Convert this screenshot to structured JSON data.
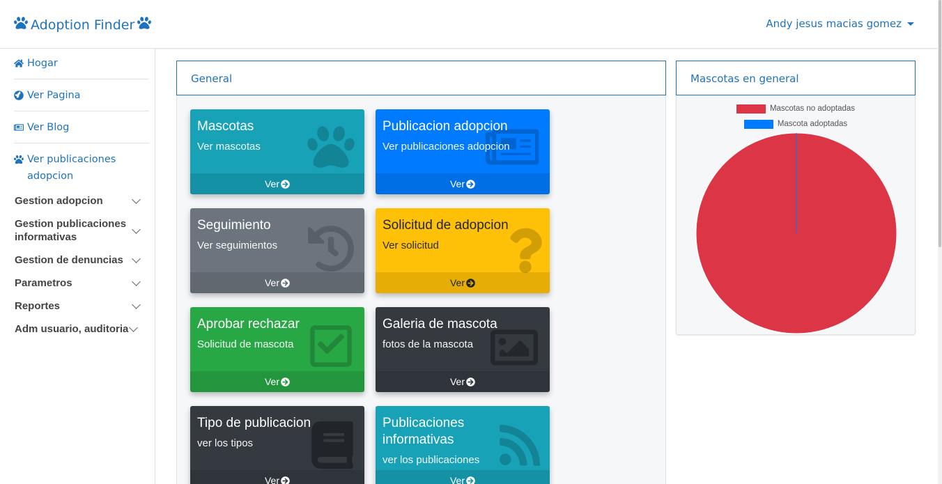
{
  "app": {
    "brand": "Adoption Finder",
    "user_name": "Andy jesus macias gomez"
  },
  "sidebar": {
    "links": [
      {
        "label": "Hogar",
        "icon": "home-icon"
      },
      {
        "label": "Ver Pagina",
        "icon": "globe-icon"
      },
      {
        "label": "Ver Blog",
        "icon": "newspaper-icon"
      },
      {
        "label": "Ver publicaciones adopcion",
        "icon": "paw-icon"
      }
    ],
    "groups": [
      {
        "label": "Gestion adopcion"
      },
      {
        "label": "Gestion publicaciones informativas"
      },
      {
        "label": "Gestion de denuncias"
      },
      {
        "label": "Parametros"
      },
      {
        "label": "Reportes"
      },
      {
        "label": "Adm usuario, auditoria"
      }
    ]
  },
  "general": {
    "title": "General",
    "tiles": [
      {
        "title": "Mascotas",
        "subtitle": "Ver mascotas",
        "footer": "Ver",
        "color": "#17a2b8",
        "icon": "paw-icon"
      },
      {
        "title": "Publicacion adopcion",
        "subtitle": "Ver publicaciones adopcion",
        "footer": "Ver",
        "color": "#007bff",
        "icon": "newspaper-icon"
      },
      {
        "title": "Seguimiento",
        "subtitle": "Ver seguimientos",
        "footer": "Ver",
        "color": "#6c757d",
        "icon": "history-icon"
      },
      {
        "title": "Solicitud de adopcion",
        "subtitle": "Ver solicitud",
        "footer": "Ver",
        "color": "#ffc107",
        "icon": "question-icon"
      },
      {
        "title": "Aprobar rechazar",
        "subtitle": "Solicitud de mascota",
        "footer": "Ver",
        "color": "#28a745",
        "icon": "check-square-icon"
      },
      {
        "title": "Galeria de mascota",
        "subtitle": "fotos de la mascota",
        "footer": "Ver",
        "color": "#343a40",
        "icon": "image-icon"
      },
      {
        "title": "Tipo de publicacion",
        "subtitle": "ver los tipos",
        "footer": "Ver",
        "color": "#343a40",
        "icon": "book-icon"
      },
      {
        "title": "Publicaciones informativas",
        "subtitle": "ver los publicaciones",
        "footer": "Ver",
        "color": "#17a2b8",
        "icon": "rss-icon"
      }
    ]
  },
  "chart_panel": {
    "title": "Mascotas en general",
    "chart_data": {
      "type": "pie",
      "title": "",
      "categories": [
        "Mascotas no adoptadas",
        "Mascota adoptadas"
      ],
      "values": [
        100,
        0
      ],
      "colors": [
        "#dc3545",
        "#007bff"
      ],
      "legend": "top"
    }
  }
}
